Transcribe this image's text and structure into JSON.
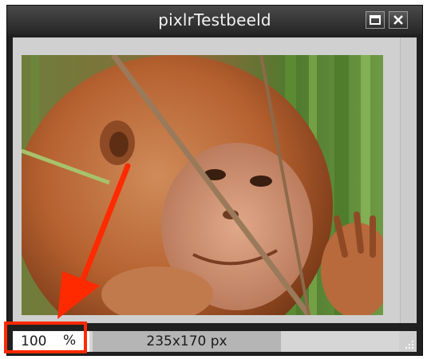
{
  "window": {
    "title": "pixlrTestbeeld"
  },
  "titlebar_buttons": [
    {
      "name": "maximize",
      "icon": "maximize-icon"
    },
    {
      "name": "close",
      "icon": "close-icon"
    }
  ],
  "status": {
    "zoom_value": "100",
    "zoom_unit": "%",
    "image_size": "235x170 px"
  },
  "colors": {
    "annotation": "#ff2a00",
    "window_frame": "#202020",
    "canvas_background": "#d0d0d0"
  }
}
